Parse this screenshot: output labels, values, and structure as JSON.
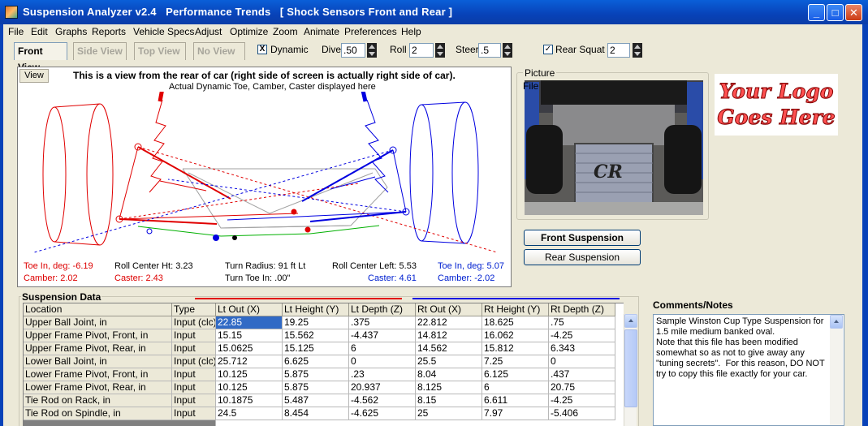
{
  "window": {
    "title": "Suspension Analyzer v2.4   Performance Trends   [ Shock Sensors Front and Rear ]",
    "minimize": "_",
    "maximize": "□",
    "close": "✕"
  },
  "menu": [
    "File",
    "Edit",
    "Graphs",
    "Reports",
    "Vehicle Specs",
    "Adjust",
    "Optimize",
    "Zoom",
    "Animate",
    "Preferences",
    "Help"
  ],
  "tabs": [
    "Front View",
    "Side View",
    "Top View",
    "No View"
  ],
  "toolbar": {
    "dynamic_label": "Dynamic",
    "dynamic_checked": "X",
    "dive_label": "Dive",
    "dive_value": ".50",
    "roll_label": "Roll",
    "roll_value": "2",
    "steer_label": "Steer",
    "steer_value": ".5",
    "rear_squat_label": "Rear Squat",
    "rear_squat_checked": "✓",
    "rear_squat_value": "2"
  },
  "view": {
    "button": "View",
    "title": "This is a view from the rear of car (right side of screen is actually right side of car).",
    "subtitle": "Actual Dynamic Toe, Camber, Caster displayed here",
    "stats": {
      "lt_toe": "Toe In, deg: -6.19",
      "lt_camber": "Camber: 2.02",
      "roll_center_ht": "Roll Center Ht: 3.23",
      "lt_caster": "Caster: 2.43",
      "turn_radius": "Turn Radius: 91 ft Lt",
      "turn_toe": "Turn Toe In: .00\"",
      "roll_center_left": "Roll Center Left: 5.53",
      "rt_caster": "Caster: 4.61",
      "rt_toe": "Toe In, deg: 5.07",
      "rt_camber": "Camber: -2.02"
    }
  },
  "picture": {
    "legend": "Picture",
    "file": "File",
    "emblem": "CR"
  },
  "logo": {
    "line1": "Your Logo",
    "line2": "Goes Here"
  },
  "buttons": {
    "front": "Front Suspension",
    "rear": "Rear Suspension"
  },
  "data": {
    "legend": "Suspension Data",
    "columns": [
      "Location",
      "Type",
      "Lt Out (X)",
      "Lt Height (Y)",
      "Lt Depth (Z)",
      "Rt Out (X)",
      "Rt Height (Y)",
      "Rt Depth (Z)"
    ],
    "rows": [
      [
        "Upper Ball Joint, in",
        "Input (clc)",
        "22.85",
        "19.25",
        ".375",
        "22.812",
        "18.625",
        ".75"
      ],
      [
        "Upper Frame Pivot, Front, in",
        "Input",
        "15.15",
        "15.562",
        "-4.437",
        "14.812",
        "16.062",
        "-4.25"
      ],
      [
        "Upper Frame Pivot, Rear, in",
        "Input",
        "15.0625",
        "15.125",
        "6",
        "14.562",
        "15.812",
        "6.343"
      ],
      [
        "Lower Ball Joint, in",
        "Input (clc)",
        "25.712",
        "6.625",
        "0",
        "25.5",
        "7.25",
        "0"
      ],
      [
        "Lower Frame Pivot, Front, in",
        "Input",
        "10.125",
        "5.875",
        ".23",
        "8.04",
        "6.125",
        ".437"
      ],
      [
        "Lower Frame Pivot, Rear, in",
        "Input",
        "10.125",
        "5.875",
        "20.937",
        "8.125",
        "6",
        "20.75"
      ],
      [
        "Tie Rod on Rack, in",
        "Input",
        "10.1875",
        "5.487",
        "-4.562",
        "8.15",
        "6.611",
        "-4.25"
      ],
      [
        "Tie Rod on Spindle, in",
        "Input",
        "24.5",
        "8.454",
        "-4.625",
        "25",
        "7.97",
        "-5.406"
      ]
    ]
  },
  "comments": {
    "title": "Comments/Notes",
    "text": "Sample Winston Cup Type Suspension for 1.5 mile medium banked oval.\nNote that this file has been modified somewhat so as not to give away any \"tuning secrets\".  For this reason, DO NOT try to copy this file exactly for your car."
  },
  "colors": {
    "left": "#e00000",
    "right": "#0000e0",
    "titlebar": "#0a5fd8"
  }
}
